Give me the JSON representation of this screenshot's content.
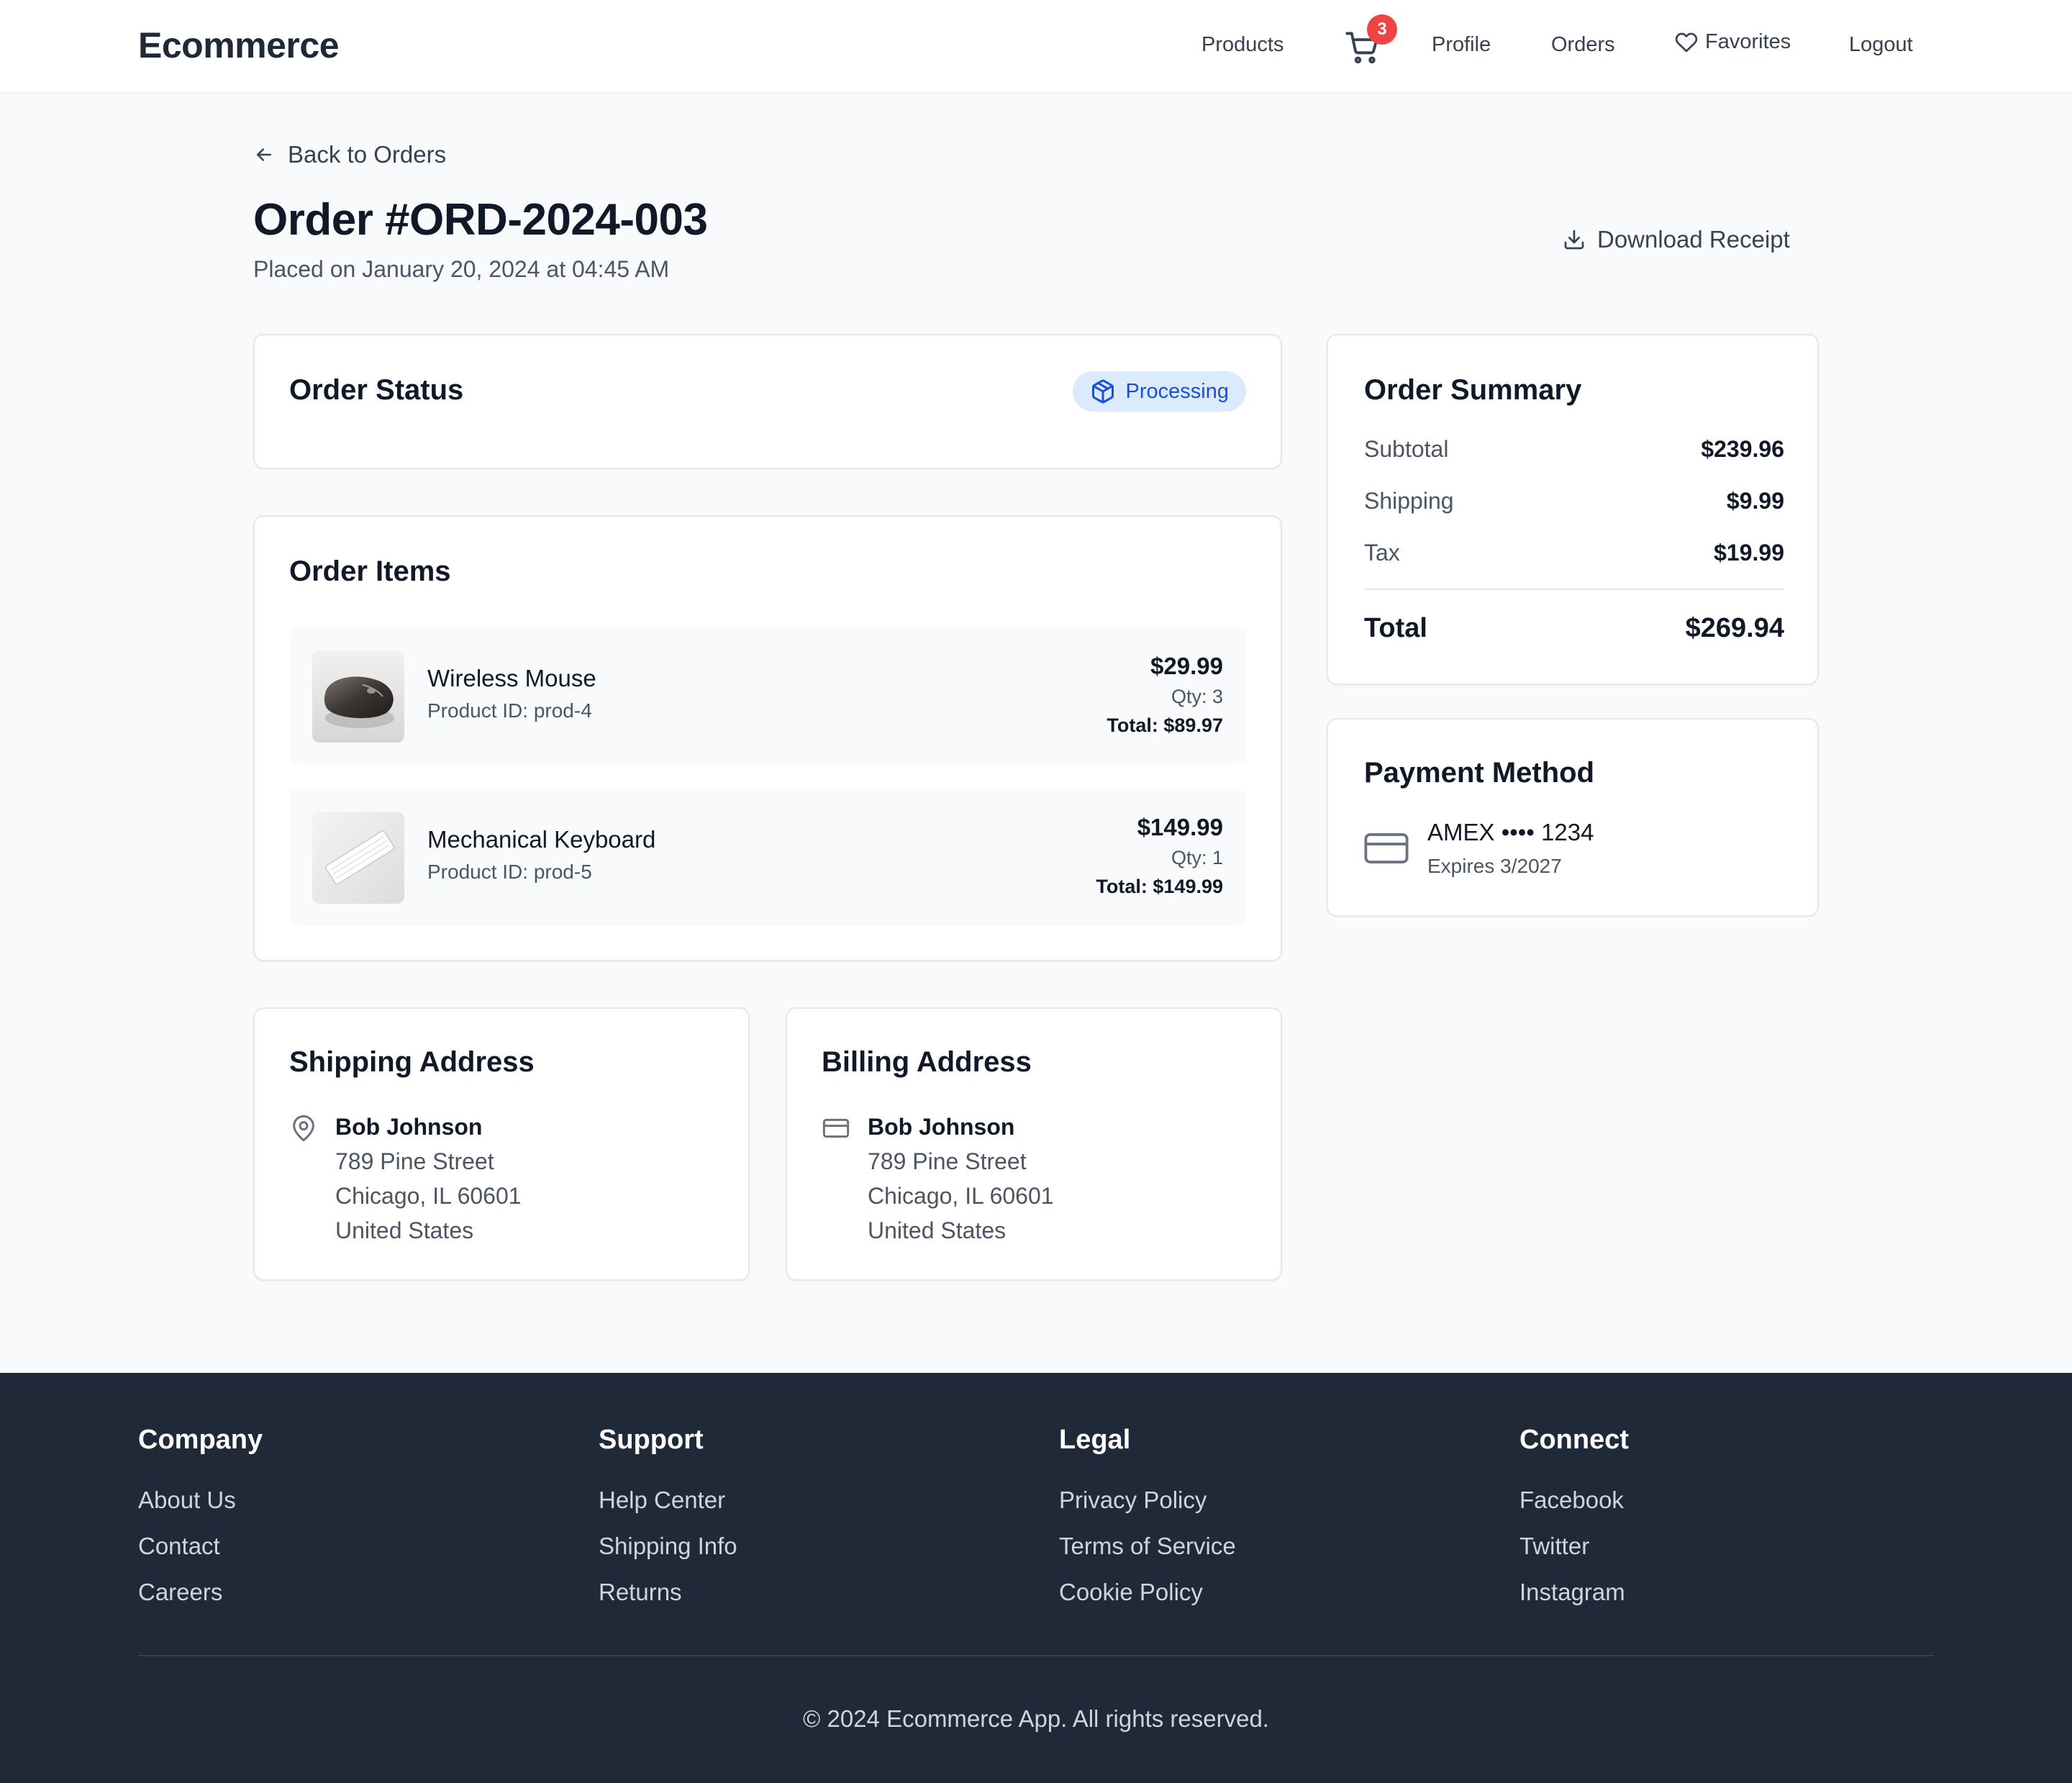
{
  "nav": {
    "brand": "Ecommerce",
    "products": "Products",
    "cart_count": "3",
    "profile": "Profile",
    "orders": "Orders",
    "favorites": "Favorites",
    "logout": "Logout"
  },
  "header": {
    "back_label": "Back to Orders",
    "title": "Order #ORD-2024-003",
    "placed_on": "Placed on January 20, 2024 at 04:45 AM",
    "download_label": "Download Receipt"
  },
  "status": {
    "title": "Order Status",
    "value": "Processing",
    "color": "#1d4ed8",
    "bg": "#dbeafe"
  },
  "items": {
    "title": "Order Items",
    "list": [
      {
        "name": "Wireless Mouse",
        "product_id": "Product ID: prod-4",
        "price": "$29.99",
        "qty": "Qty: 3",
        "total": "Total: $89.97"
      },
      {
        "name": "Mechanical Keyboard",
        "product_id": "Product ID: prod-5",
        "price": "$149.99",
        "qty": "Qty: 1",
        "total": "Total: $149.99"
      }
    ]
  },
  "shipping": {
    "title": "Shipping Address",
    "name": "Bob Johnson",
    "street": "789 Pine Street",
    "city": "Chicago, IL 60601",
    "country": "United States"
  },
  "billing": {
    "title": "Billing Address",
    "name": "Bob Johnson",
    "street": "789 Pine Street",
    "city": "Chicago, IL 60601",
    "country": "United States"
  },
  "summary": {
    "title": "Order Summary",
    "subtotal_label": "Subtotal",
    "subtotal": "$239.96",
    "shipping_label": "Shipping",
    "shipping": "$9.99",
    "tax_label": "Tax",
    "tax": "$19.99",
    "total_label": "Total",
    "total": "$269.94"
  },
  "payment": {
    "title": "Payment Method",
    "card": "AMEX •••• 1234",
    "expires": "Expires 3/2027"
  },
  "footer": {
    "columns": [
      {
        "heading": "Company",
        "links": [
          "About Us",
          "Contact",
          "Careers"
        ]
      },
      {
        "heading": "Support",
        "links": [
          "Help Center",
          "Shipping Info",
          "Returns"
        ]
      },
      {
        "heading": "Legal",
        "links": [
          "Privacy Policy",
          "Terms of Service",
          "Cookie Policy"
        ]
      },
      {
        "heading": "Connect",
        "links": [
          "Facebook",
          "Twitter",
          "Instagram"
        ]
      }
    ],
    "copyright": "© 2024 Ecommerce App. All rights reserved."
  },
  "icons": {
    "cart": "cart-icon",
    "heart": "heart-icon",
    "back": "arrow-left-icon",
    "download": "download-icon",
    "status": "package-icon",
    "location": "map-pin-icon",
    "billing": "credit-card-icon",
    "payment": "credit-card-icon"
  },
  "colors": {
    "brand_text": "#1f2937",
    "badge": "#ef4444",
    "footer_bg": "#1f2937",
    "page_bg": "#f9fafb"
  }
}
